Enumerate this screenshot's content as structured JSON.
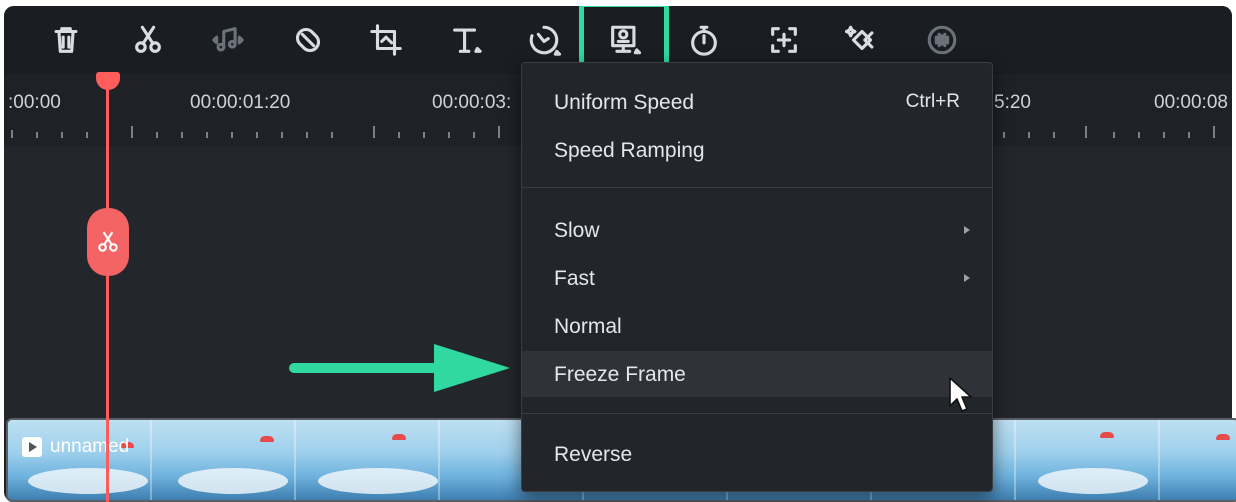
{
  "toolbar": {
    "tools": [
      {
        "icon": "trash-icon"
      },
      {
        "icon": "scissors-icon"
      },
      {
        "icon": "audio-detach-icon"
      },
      {
        "icon": "mask-icon"
      },
      {
        "icon": "crop-icon"
      },
      {
        "icon": "text-icon"
      },
      {
        "icon": "speed-icon"
      },
      {
        "icon": "freeze-frame-icon"
      },
      {
        "icon": "duration-timer-icon"
      },
      {
        "icon": "add-keyframe-icon"
      },
      {
        "icon": "ai-effect-icon"
      },
      {
        "icon": "voice-icon"
      }
    ],
    "highlight_color": "#2fd9a0"
  },
  "ruler": {
    "timecodes": [
      ":00:00",
      "00:00:01:20",
      "00:00:03:",
      "5:20",
      "00:00:08"
    ]
  },
  "clip": {
    "name": "unnamed"
  },
  "speed_menu": {
    "items": [
      {
        "label": "Uniform Speed",
        "shortcut": "Ctrl+R"
      },
      {
        "label": "Speed Ramping"
      },
      {
        "label": "Slow",
        "submenu": true
      },
      {
        "label": "Fast",
        "submenu": true
      },
      {
        "label": "Normal"
      },
      {
        "label": "Freeze Frame",
        "hovered": true
      },
      {
        "label": "Reverse"
      }
    ]
  },
  "colors": {
    "playhead": "#ff5c5c",
    "arrow": "#2fd9a0"
  }
}
